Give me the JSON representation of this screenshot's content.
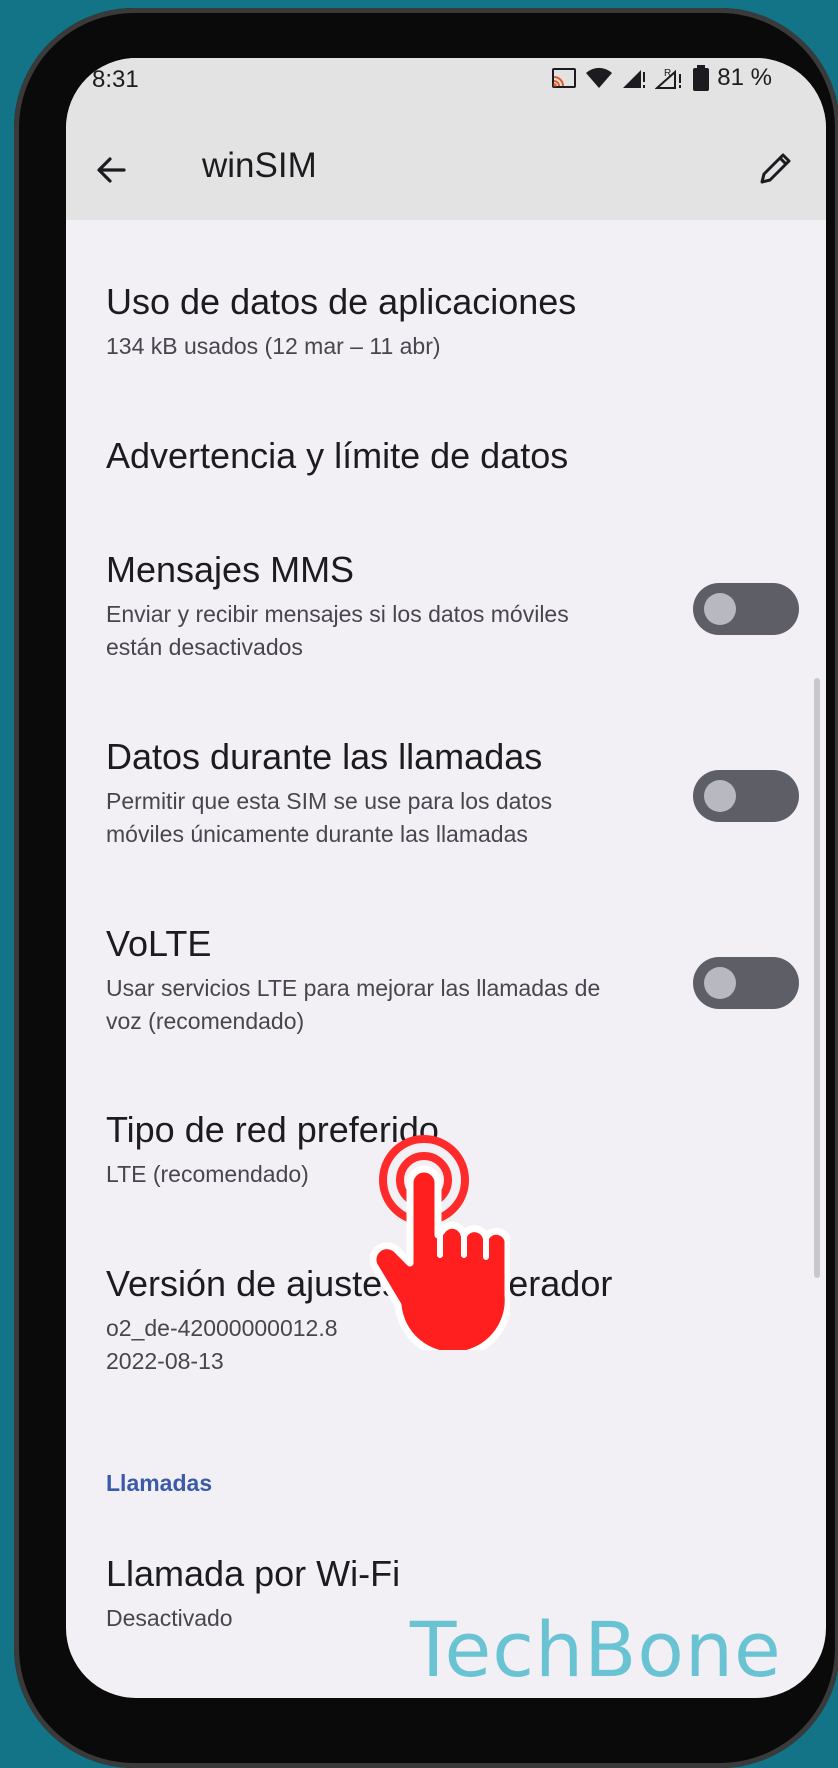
{
  "status": {
    "time": "8:31",
    "battery": "81 %"
  },
  "header": {
    "title": "winSIM"
  },
  "items": [
    {
      "title": "Uso de datos de aplicaciones",
      "subtitle": "134 kB usados (12 mar – 11 abr)"
    },
    {
      "title": "Advertencia y límite de datos"
    },
    {
      "title": "Mensajes MMS",
      "subtitle": "Enviar y recibir mensajes si los datos móviles están desactivados",
      "toggle": false
    },
    {
      "title": "Datos durante las llamadas",
      "subtitle": "Permitir que esta SIM se use para los datos móviles únicamente durante las llamadas",
      "toggle": false
    },
    {
      "title": "VoLTE",
      "subtitle": "Usar servicios LTE para mejorar las llamadas de voz (recomendado)",
      "toggle": false
    },
    {
      "title": "Tipo de red preferido",
      "subtitle": "LTE (recomendado)"
    },
    {
      "title": "Versión de ajustes del operador",
      "subtitle_line1": "o2_de-42000000012.8",
      "subtitle_line2": "2022-08-13"
    },
    {
      "title": "Llamada por Wi-Fi",
      "subtitle": "Desactivado"
    }
  ],
  "section": {
    "calls": "Llamadas"
  },
  "watermark": "TechBone",
  "icons": [
    "back-arrow-icon",
    "edit-pencil-icon",
    "cast-icon",
    "wifi-icon",
    "signal-icon",
    "roaming-signal-icon",
    "battery-icon",
    "tap-hand-icon"
  ]
}
